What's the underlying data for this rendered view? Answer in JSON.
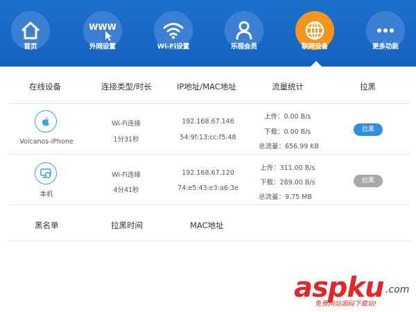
{
  "nav": [
    {
      "label": "首页",
      "icon": "home-icon"
    },
    {
      "label": "外网设置",
      "icon": "www-icon",
      "icon_text": "WWW"
    },
    {
      "label": "Wi-Fi设置",
      "icon": "wifi-icon"
    },
    {
      "label": "乐视会员",
      "icon": "user-icon"
    },
    {
      "label": "联网设备",
      "icon": "globe-icon",
      "active": true
    },
    {
      "label": "更多功能",
      "icon": "more-icon"
    }
  ],
  "colors": {
    "nav_bg": "#1562c0",
    "active": "#f7941d",
    "accent": "#35a4de",
    "button_blue": "#2d8fdd",
    "button_gray": "#a9a9a9"
  },
  "table": {
    "headers": [
      "在线设备",
      "连接类型/时长",
      "IP地址/MAC地址",
      "流量统计",
      "拉黑"
    ],
    "rows": [
      {
        "device": "Volcanos-iPhone",
        "icon": "apple-icon",
        "conn_type": "Wi-Fi连接",
        "duration": "1分31秒",
        "ip": "192.168.67.146",
        "mac": "54:9f:13:cc:f5:48",
        "upload": "上传：0.00 B/s",
        "download": "下载：0.00 B/s",
        "total": "总流量：656.99 KB",
        "button": "拉黑",
        "button_state": "enabled"
      },
      {
        "device": "本机",
        "icon": "computer-icon",
        "conn_type": "Wi-Fi连接",
        "duration": "4分41秒",
        "ip": "192.168.67.120",
        "mac": "74:e5:43:e3:a6:3e",
        "upload": "上传：311.00 B/s",
        "download": "下载：289.00 B/s",
        "total": "总流量：9.75 MB",
        "button": "拉黑",
        "button_state": "disabled"
      }
    ]
  },
  "blacklist": {
    "headers": [
      "黑名单",
      "拉黑时间",
      "MAC地址"
    ]
  },
  "watermark": {
    "brand": "aspku",
    "tld": ".com",
    "tagline": "免费网站源码下载站!"
  }
}
